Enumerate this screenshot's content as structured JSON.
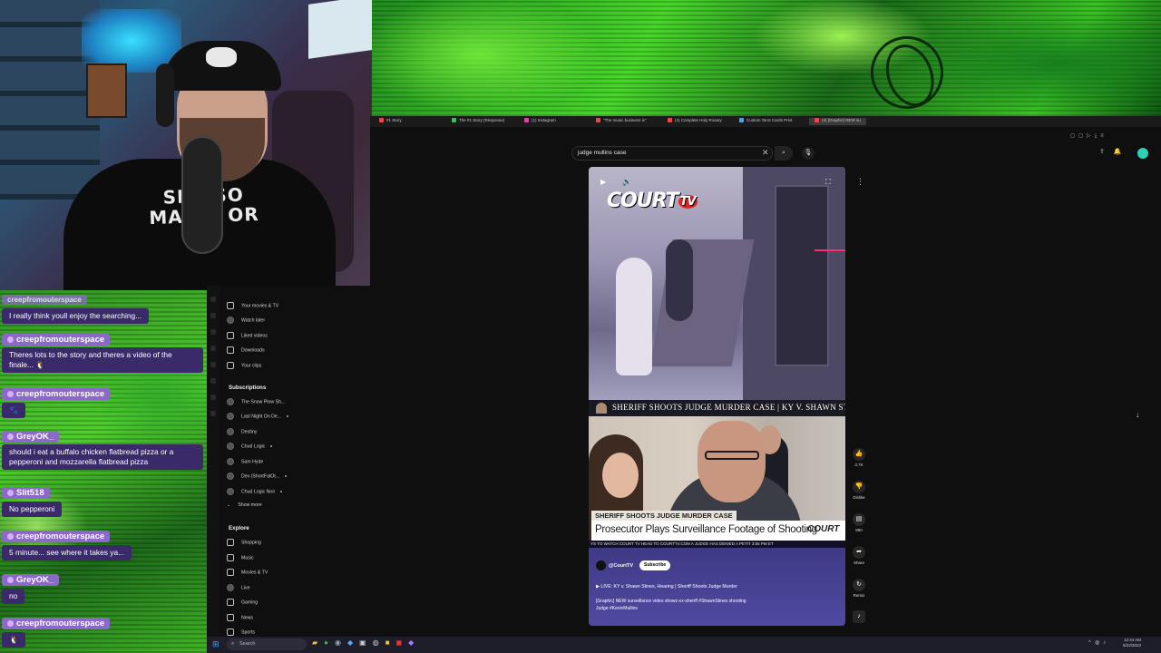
{
  "overlay": {
    "shirt_text": "SHE SO\nMAZIN OR\nME"
  },
  "chat": {
    "messages": [
      {
        "user": "",
        "text": "I really think youll enjoy the searching..."
      },
      {
        "user": "creepfromouterspace",
        "text": "Theres lots to the story and theres a video of the finale... 🐧"
      },
      {
        "user": "creepfromouterspace",
        "text": "🐾"
      },
      {
        "user": "GreyOK_",
        "text": "should i eat a buffalo chicken flatbread pizza or a pepperoni and mozzarella flatbread pizza"
      },
      {
        "user": "Slit518",
        "text": "No pepperoni"
      },
      {
        "user": "creepfromouterspace",
        "text": "5 minute... see where it takes ya..."
      },
      {
        "user": "GreyOK_",
        "text": "no"
      },
      {
        "user": "creepfromouterspace",
        "text": "🐧"
      }
    ],
    "top_user": "creepfromouterspace"
  },
  "browser": {
    "tabs": [
      {
        "label": "#1 Story",
        "color": "#e34b4b"
      },
      {
        "label": "The #1 Story (Response)",
        "color": "#3cbf5a"
      },
      {
        "label": "(1) Instagram",
        "color": "#d54a9a"
      },
      {
        "label": "\"The music business is\"",
        "color": "#e34b4b"
      },
      {
        "label": "(4) Complete Holy Rosary",
        "color": "#e34b4b"
      },
      {
        "label": "Custom Tarot Cards Print",
        "color": "#4aa5e0"
      },
      {
        "label": "(4) [Graphic] NEW su",
        "color": "#e34b4b",
        "active": true
      }
    ]
  },
  "youtube": {
    "search": {
      "query": "judge mullins case"
    },
    "nav": {
      "you_items": [
        "Your movies & TV",
        "Watch later",
        "Liked videos",
        "Downloads",
        "Your clips"
      ],
      "subscriptions_title": "Subscriptions",
      "subscriptions": [
        "The Snow Plow Sh...",
        "Last Night On De...",
        "Destiny",
        "Chud Logic",
        "Sam Hyde",
        "Dev (ShortFatOt...",
        "Chud Logic Noir"
      ],
      "show_more": "Show more",
      "explore_title": "Explore",
      "explore": [
        "Shopping",
        "Music",
        "Movies & TV",
        "Live",
        "Gaming",
        "News",
        "Sports"
      ]
    },
    "video": {
      "banner_title": "SHERIFF SHOOTS JUDGE MURDER CASE  |  KY V. SHAWN STINES",
      "lower_label": "SHERIFF SHOOTS JUDGE MURDER CASE",
      "lower_headline": "Prosecutor Plays Surveillance Footage of Shooting",
      "ticker": "YS TO WATCH COURT TV HEAD TO COURTTV.COM     A JUDGE HAS DENIED A PETIT   3:55 PM ET",
      "court_logo": "COURT",
      "court_logo_tv": "TV",
      "lower_logo": "COURT",
      "channel": "@CourtTV",
      "subscribe": "Subscribe",
      "live_line": "▶  LIVE: KY v. Shawn Stines, Hearing | Sheriff Shoots Judge Murder",
      "description_1": "[Graphic] NEW surveillance video shows ex-sheriff #ShawnStines shooting",
      "description_2": "Judge #KevinMullins"
    },
    "actions": {
      "likes": "3.7K",
      "dislike": "Dislike",
      "comments": "890",
      "share": "Share",
      "remix": "Remix"
    }
  },
  "taskbar": {
    "search_placeholder": "Search",
    "time": "12:44 AM",
    "date": "8/22/2023"
  }
}
